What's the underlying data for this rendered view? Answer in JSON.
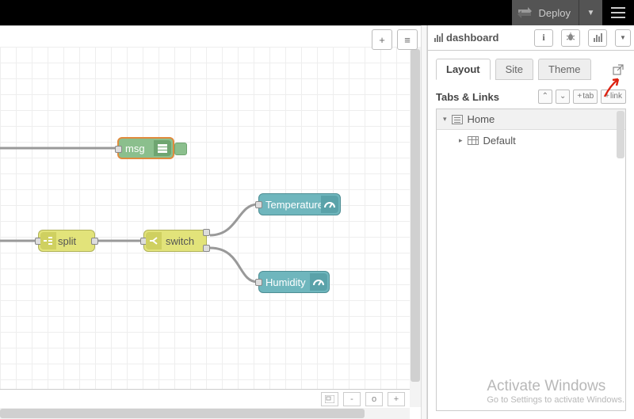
{
  "topbar": {
    "deploy_label": "Deploy"
  },
  "canvas": {
    "nodes": {
      "debug_label": "msg",
      "split_label": "split",
      "switch_label": "switch",
      "gauge1_label": "Temperature",
      "gauge2_label": "Humidity"
    },
    "footer": {
      "zoom_out": "-",
      "zoom_reset": "o",
      "zoom_in": "+"
    },
    "toolbar": {
      "add": "+",
      "list": "≡"
    }
  },
  "sidebar": {
    "panel_title": "dashboard",
    "tabs": {
      "layout": "Layout",
      "site": "Site",
      "theme": "Theme"
    },
    "section_title": "Tabs & Links",
    "buttons": {
      "expand": "⌃",
      "collapse": "⌄",
      "add_tab": "tab",
      "add_link": "link"
    },
    "tree": {
      "home": "Home",
      "default": "Default"
    }
  },
  "watermark": {
    "line1": "Activate Windows",
    "line2": "Go to Settings to activate Windows."
  }
}
